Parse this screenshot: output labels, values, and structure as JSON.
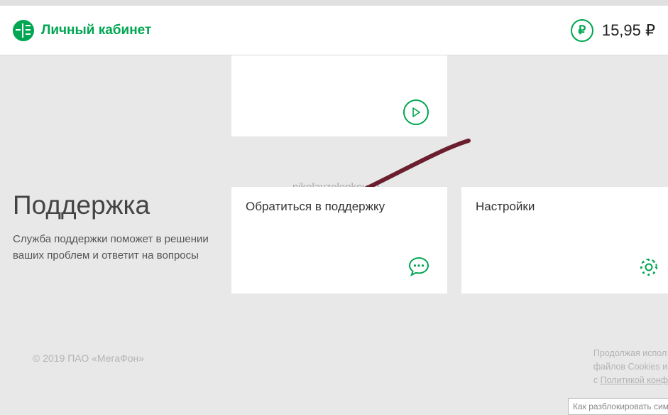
{
  "header": {
    "title": "Личный кабинет",
    "balance": "15,95 ₽",
    "currency_symbol": "₽"
  },
  "watermark": "nikolayzelenkov.ru",
  "section": {
    "title": "Поддержка",
    "description": "Служба поддержки поможет в решении ваших проблем и ответит на вопросы"
  },
  "cards": {
    "support": "Обратиться в поддержку",
    "settings": "Настройки"
  },
  "footer": {
    "copyright": "© 2019 ПАО «МегаФон»",
    "cookies_line1": "Продолжая испол",
    "cookies_line2": "файлов Cookies и",
    "cookies_line3_prefix": "с ",
    "cookies_line3_link": "Политикой конф"
  },
  "bottom_input": "Как разблокировать симкар"
}
